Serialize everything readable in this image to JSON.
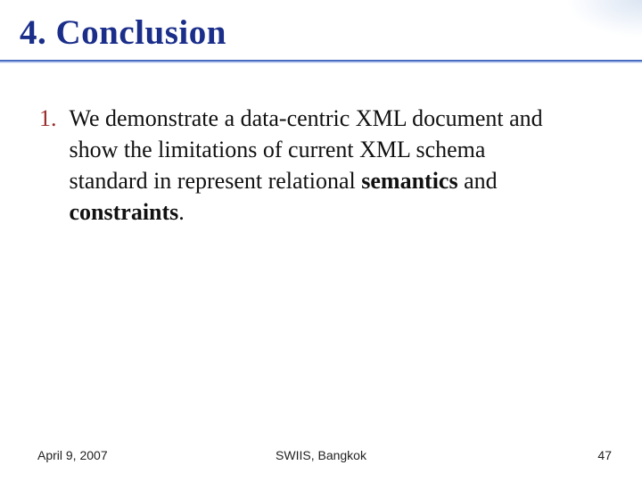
{
  "title": "4. Conclusion",
  "list": {
    "items": [
      {
        "marker": "1.",
        "text_pre": "We demonstrate a data-centric XML document and show the limitations of current XML schema standard in represent relational ",
        "bold1": "semantics",
        "mid": " and ",
        "bold2": "constraints",
        "post": "."
      }
    ]
  },
  "footer": {
    "date": "April 9, 2007",
    "venue": "SWIIS, Bangkok",
    "page": "47"
  }
}
